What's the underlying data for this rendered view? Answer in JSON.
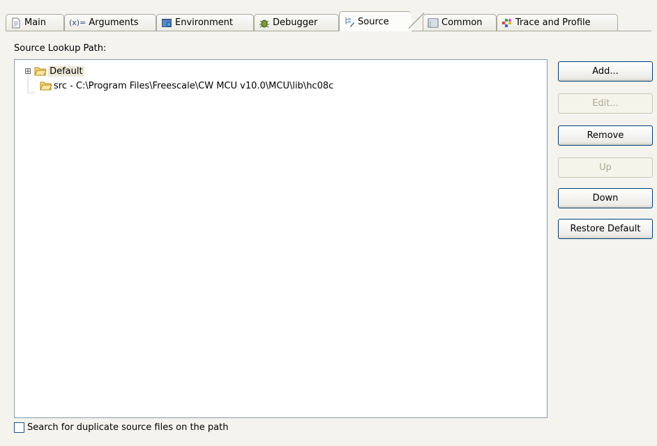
{
  "tabs": [
    {
      "label": "Main",
      "icon": "document-icon",
      "active": false
    },
    {
      "label": "Arguments",
      "icon_text": "(x)=",
      "icon": "arguments-icon",
      "active": false
    },
    {
      "label": "Environment",
      "icon": "environment-icon",
      "active": false
    },
    {
      "label": "Debugger",
      "icon": "bug-icon",
      "active": false
    },
    {
      "label": "Source",
      "icon": "source-icon",
      "active": true
    },
    {
      "label": "Common",
      "icon": "common-icon",
      "active": false
    },
    {
      "label": "Trace and Profile",
      "icon": "trace-profile-icon",
      "active": false
    }
  ],
  "source_lookup": {
    "label": "Source Lookup Path:",
    "items": [
      {
        "label": "Default",
        "expander": "⊞",
        "icon": "folder-icon"
      },
      {
        "label": "src - C:\\Program Files\\Freescale\\CW MCU v10.0\\MCU\\lib\\hc08c",
        "icon": "folder-icon"
      }
    ]
  },
  "buttons": {
    "add": "Add...",
    "edit": "Edit...",
    "remove": "Remove",
    "up": "Up",
    "down": "Down",
    "restore_default": "Restore Default"
  },
  "duplicate_search": {
    "label": "Search for duplicate source files on the path",
    "checked": false
  },
  "colors": {
    "background": "#f4f3ee",
    "tree_border": "#7f9db9",
    "button_border": "#003c74",
    "folder": "#f2c94c"
  }
}
